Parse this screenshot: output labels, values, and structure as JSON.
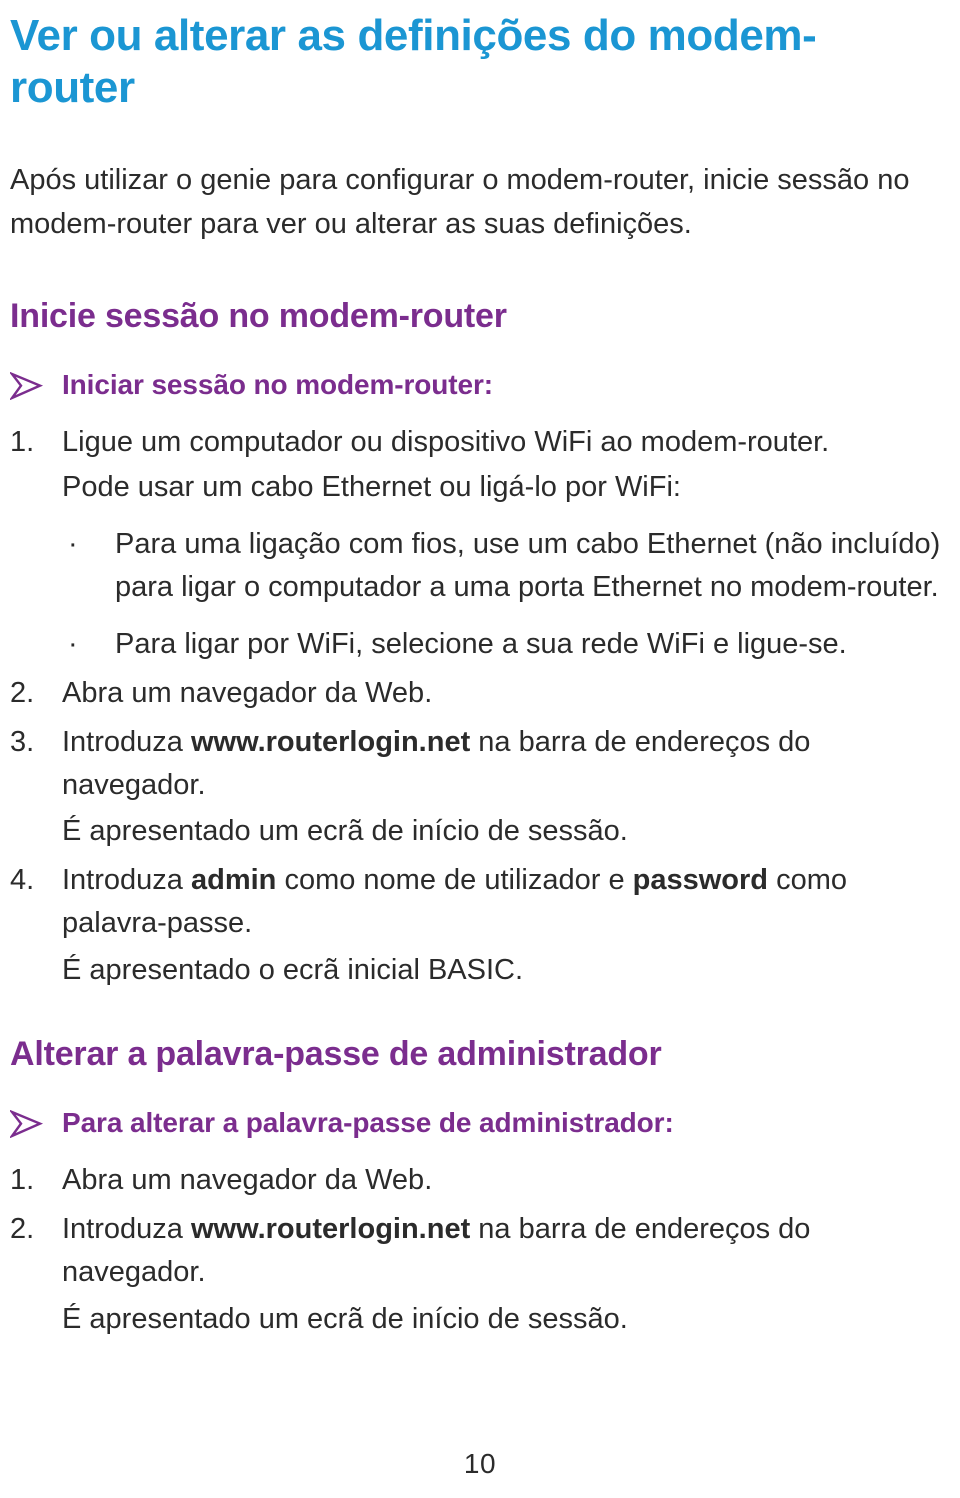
{
  "colors": {
    "title_blue": "#1b96d3",
    "heading_purple": "#7b2d8e",
    "body_text": "#2b2b2b"
  },
  "title": "Ver ou alterar as definições do modem-router",
  "intro": "Após utilizar o genie para configurar o modem-router, inicie sessão no modem-router para ver ou alterar as suas definições.",
  "sections": [
    {
      "heading": "Inicie sessão no modem-router",
      "procedure_title": "Iniciar sessão no modem-router:",
      "steps": [
        {
          "number": "1.",
          "text": "Ligue um computador ou dispositivo WiFi ao modem-router.",
          "sub_text": "Pode usar um cabo Ethernet ou ligá-lo por WiFi:",
          "bullets": [
            "Para uma ligação com fios, use um cabo Ethernet (não incluído) para ligar o computador a uma porta Ethernet no modem-router.",
            "Para ligar por WiFi, selecione a sua rede WiFi e ligue-se."
          ]
        },
        {
          "number": "2.",
          "text": "Abra um navegador da Web."
        },
        {
          "number": "3.",
          "text_pre": "Introduza ",
          "text_bold": "www.routerlogin.net",
          "text_post": " na barra de endereços do navegador.",
          "result": "É apresentado um ecrã de início de sessão."
        },
        {
          "number": "4.",
          "text_pre": "Introduza ",
          "text_bold": "admin",
          "text_mid": " como nome de utilizador e ",
          "text_bold2": "password",
          "text_post": " como palavra-passe.",
          "result": "É apresentado o ecrã inicial BASIC."
        }
      ]
    },
    {
      "heading": "Alterar a palavra-passe de administrador",
      "procedure_title": "Para alterar a palavra-passe de administrador:",
      "steps": [
        {
          "number": "1.",
          "text": "Abra um navegador da Web."
        },
        {
          "number": "2.",
          "text_pre": "Introduza ",
          "text_bold": "www.routerlogin.net",
          "text_post": " na barra de endereços do navegador.",
          "result": "É apresentado um ecrã de início de sessão."
        }
      ]
    }
  ],
  "bullet_glyph": "·",
  "page_number": "10"
}
